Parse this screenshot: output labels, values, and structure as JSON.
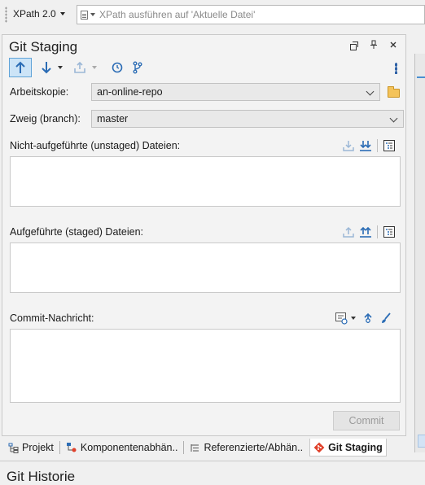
{
  "toolbar": {
    "xpath_version": "XPath 2.0",
    "xpath_placeholder": "XPath ausführen auf  'Aktuelle Datei'"
  },
  "panel": {
    "title": "Git Staging",
    "working_copy_label": "Arbeitskopie:",
    "working_copy_value": "an-online-repo",
    "branch_label": "Zweig (branch):",
    "branch_value": "master",
    "unstaged_label": "Nicht-aufgeführte (unstaged) Dateien:",
    "staged_label": "Aufgeführte (staged) Dateien:",
    "commit_label": "Commit-Nachricht:",
    "commit_button": "Commit"
  },
  "tabs": [
    {
      "label": "Projekt",
      "active": false
    },
    {
      "label": "Komponentenabhän..",
      "active": false
    },
    {
      "label": "Referenzierte/Abhän..",
      "active": false
    },
    {
      "label": "Git Staging",
      "active": true
    }
  ],
  "next_panel_title": "Git Historie",
  "colors": {
    "accent_blue": "#2b6cb5",
    "active_button_bg": "#cce4f7",
    "git_red": "#e0402a"
  }
}
